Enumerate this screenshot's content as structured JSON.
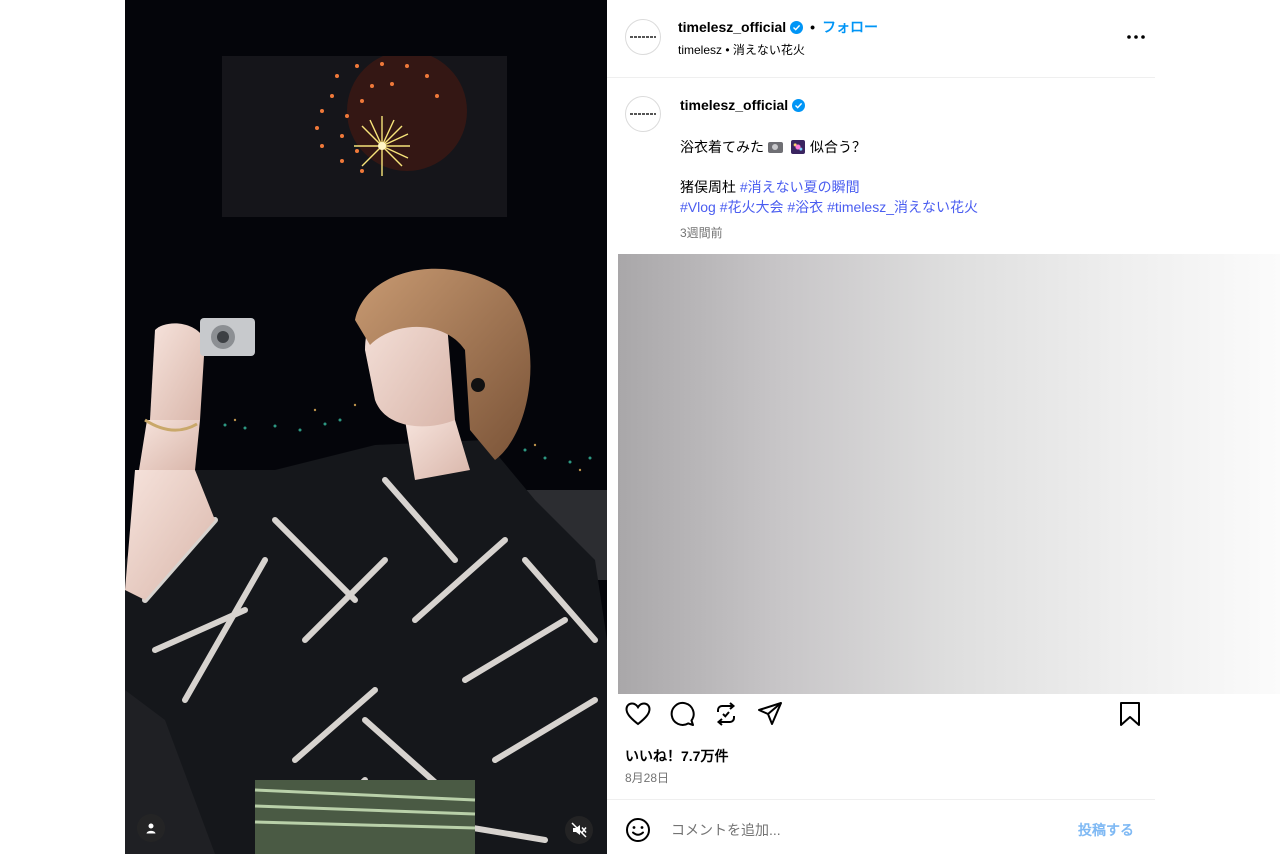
{
  "media": {
    "description_icons": [
      "user-tag-icon",
      "speaker-muted-icon"
    ]
  },
  "header": {
    "username": "timelesz_official",
    "separator": "•",
    "follow_label": "フォロー",
    "subtitle": "timelesz • 消えない花火"
  },
  "caption": {
    "username": "timelesz_official",
    "text_before": "浴衣着てみた",
    "text_after": "似合う？",
    "credit": "猪俣周杜",
    "tag_1": "#消えない夏の瞬間",
    "tag_2": "#Vlog",
    "tag_3": "#花火大会",
    "tag_4": "#浴衣",
    "tag_5": "#timelesz_消えない花火",
    "posted_ago": "3週間前"
  },
  "stats": {
    "likes": "いいね！7.7万件",
    "date": "8月28日"
  },
  "comment": {
    "placeholder": "コメントを追加...",
    "post_label": "投稿する"
  },
  "colors": {
    "accent": "#0095f6",
    "hashtag": "#4a5df0",
    "secondary_text": "#737373"
  }
}
